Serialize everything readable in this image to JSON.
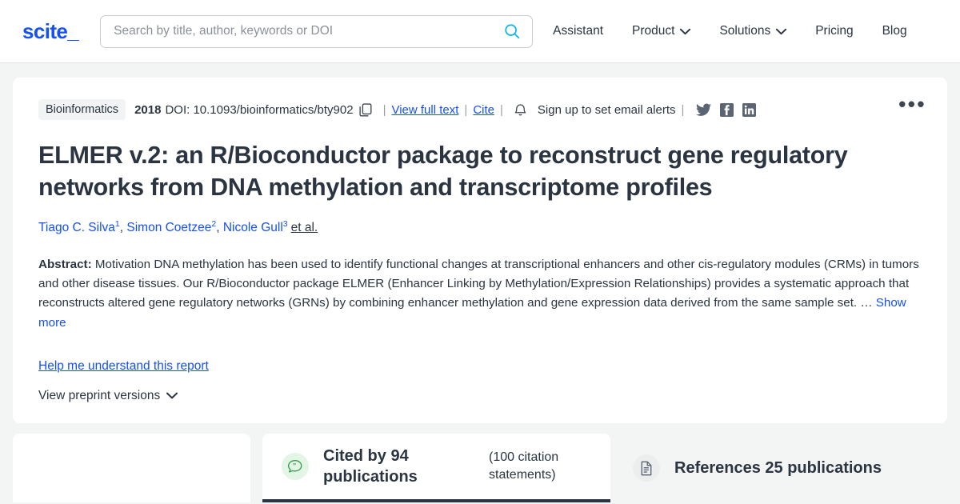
{
  "header": {
    "logo": "scite_",
    "search": {
      "placeholder": "Search by title, author, keywords or DOI",
      "value": "",
      "icon": "search-icon"
    },
    "nav": [
      {
        "label": "Assistant",
        "has_chevron": false
      },
      {
        "label": "Product",
        "has_chevron": true
      },
      {
        "label": "Solutions",
        "has_chevron": true
      },
      {
        "label": "Pricing",
        "has_chevron": false
      },
      {
        "label": "Blog",
        "has_chevron": false
      }
    ]
  },
  "paper": {
    "journal_badge": "Bioinformatics",
    "year": "2018",
    "doi_label": "DOI: 10.1093/bioinformatics/bty902",
    "copy_icon": "copy-icon",
    "separator": "|",
    "view_full_text": "View full text",
    "cite": "Cite",
    "bell_icon": "bell-icon",
    "email_alerts": "Sign up to set email alerts",
    "socials": [
      "twitter-icon",
      "facebook-icon",
      "linkedin-icon"
    ],
    "more_menu": "•••",
    "title": "ELMER v.2: an R/Bioconductor package to reconstruct gene regulatory networks from DNA methylation and transcriptome profiles",
    "authors": [
      {
        "name": "Tiago C. Silva",
        "sup": "1",
        "comma": ","
      },
      {
        "name": "Simon Coetzee",
        "sup": "2",
        "comma": ","
      },
      {
        "name": "Nicole Gull",
        "sup": "3",
        "comma": ""
      }
    ],
    "et_al": "et al.",
    "abstract_label": "Abstract:",
    "abstract_text": " Motivation DNA methylation has been used to identify functional changes at transcriptional enhancers and other cis-regulatory modules (CRMs) in tumors and other disease tissues. Our R/Bioconductor package ELMER (Enhancer Linking by Methylation/Expression Relationships) provides a systematic approach that reconstructs altered gene regulatory networks (GRNs) by combining enhancer methylation and gene expression data derived from the same sample set. … ",
    "show_more": "Show more",
    "help_link": "Help me understand this report",
    "preprint_versions": "View preprint versions",
    "preprint_chevron": "chevron-down-icon"
  },
  "tabs": {
    "cited_by": {
      "icon": "citation-bubble-icon",
      "label": "Cited by 94 publications",
      "sub": "(100 citation statements)",
      "active": true
    },
    "references": {
      "icon": "document-icon",
      "label": "References 25 publications",
      "active": false
    }
  },
  "colors": {
    "brand_blue": "#1550f5",
    "search_icon_cyan": "#06b6ef",
    "text_dark": "#2b3441",
    "page_bg": "#f3f4f4",
    "active_tab_underline": "#2b3441",
    "green_badge": "#e3f5e5",
    "green_icon": "#3a9e4e"
  }
}
